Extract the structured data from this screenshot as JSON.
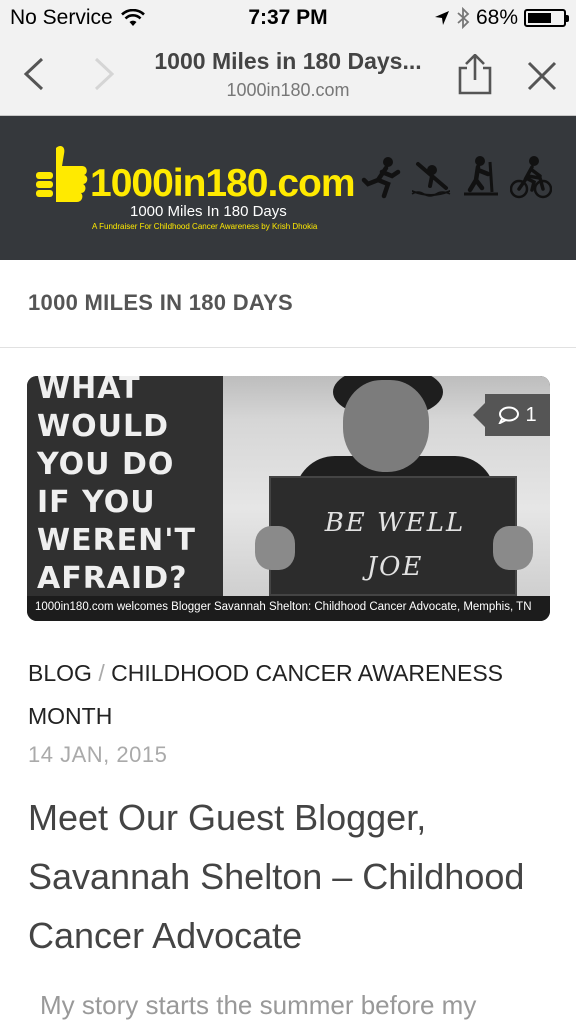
{
  "status_bar": {
    "carrier": "No Service",
    "time": "7:37 PM",
    "battery_percent": "68%",
    "battery_level": 0.68
  },
  "browser": {
    "page_title": "1000 Miles in 180 Days...",
    "host": "1000in180.com"
  },
  "site_header": {
    "logo_text": "1000in180.com",
    "tagline": "1000 Miles In 180 Days",
    "subtitle": "A Fundraiser For Childhood Cancer Awareness by Krish Dhokia",
    "logo_color": "#ffea00",
    "background": "#35383c",
    "sport_icons": [
      "running-icon",
      "kayaking-icon",
      "elliptical-icon",
      "cycling-icon"
    ]
  },
  "page": {
    "title": "1000 MILES IN 180 DAYS"
  },
  "featured": {
    "words": [
      "WHAT",
      "WOULD",
      "YOU DO",
      "IF YOU",
      "WEREN'T",
      "AFRAID?"
    ],
    "sign_line1": "BE WELL",
    "sign_line2": "JOE",
    "comment_count": "1",
    "caption": "1000in180.com welcomes Blogger Savannah Shelton: Childhood Cancer Advocate, Memphis, TN"
  },
  "post": {
    "category1": "BLOG",
    "separator": "/",
    "category2": "CHILDHOOD CANCER AWARENESS MONTH",
    "date": "14 JAN, 2015",
    "title": "Meet Our Guest Blogger, Savannah Shelton – Childhood Cancer Advocate",
    "excerpt": "My story starts the summer before my"
  }
}
